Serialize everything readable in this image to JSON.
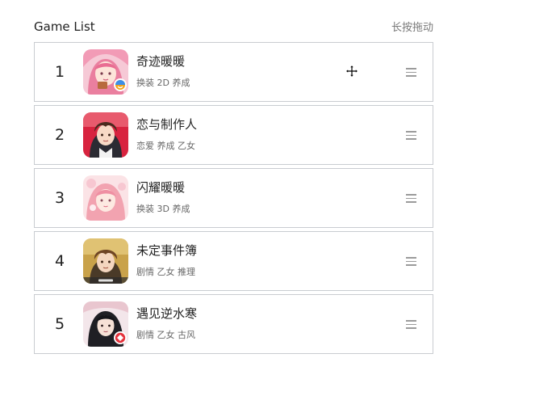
{
  "header": {
    "title": "Game List",
    "hint": "长按拖动"
  },
  "games": [
    {
      "rank": "1",
      "name": "奇迹暖暖",
      "tags": "换装 2D 养成",
      "icon": "game-icon-qijinuannuan"
    },
    {
      "rank": "2",
      "name": "恋与制作人",
      "tags": "恋爱 养成 乙女",
      "icon": "game-icon-lianyuzhizuoren"
    },
    {
      "rank": "3",
      "name": "闪耀暖暖",
      "tags": "换装 3D 养成",
      "icon": "game-icon-shanyaonuannuan"
    },
    {
      "rank": "4",
      "name": "未定事件簿",
      "tags": "剧情 乙女 推理",
      "icon": "game-icon-weidingshijianbu"
    },
    {
      "rank": "5",
      "name": "遇见逆水寒",
      "tags": "剧情 乙女 古风",
      "icon": "game-icon-yujiannishuihan"
    }
  ],
  "colors": {
    "border": "#c9ccd1",
    "text": "#222222",
    "muted": "#666666",
    "handle": "#9b9b9b"
  },
  "cursor": "move-cursor-icon",
  "drag_handle_icon": "hamburger-drag-icon"
}
